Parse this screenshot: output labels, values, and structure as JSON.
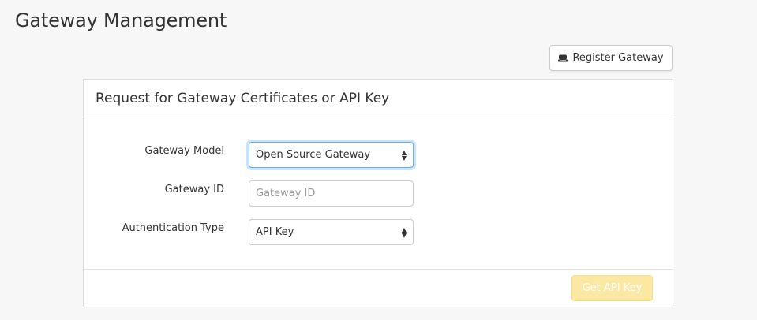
{
  "page": {
    "title": "Gateway Management"
  },
  "toolbar": {
    "register_icon": "server-icon",
    "register_label": "Register Gateway"
  },
  "panel": {
    "title": "Request for Gateway Certificates or API Key"
  },
  "form": {
    "gateway_model": {
      "label": "Gateway Model",
      "value": "Open Source Gateway"
    },
    "gateway_id": {
      "label": "Gateway ID",
      "value": "",
      "placeholder": "Gateway ID"
    },
    "auth_type": {
      "label": "Authentication Type",
      "value": "API Key"
    }
  },
  "footer": {
    "submit_label": "Get API Key"
  },
  "colors": {
    "background": "#f7f7f7",
    "panel": "#ffffff",
    "focus_border": "#66afe9",
    "submit_disabled": "#fbe8a3"
  }
}
